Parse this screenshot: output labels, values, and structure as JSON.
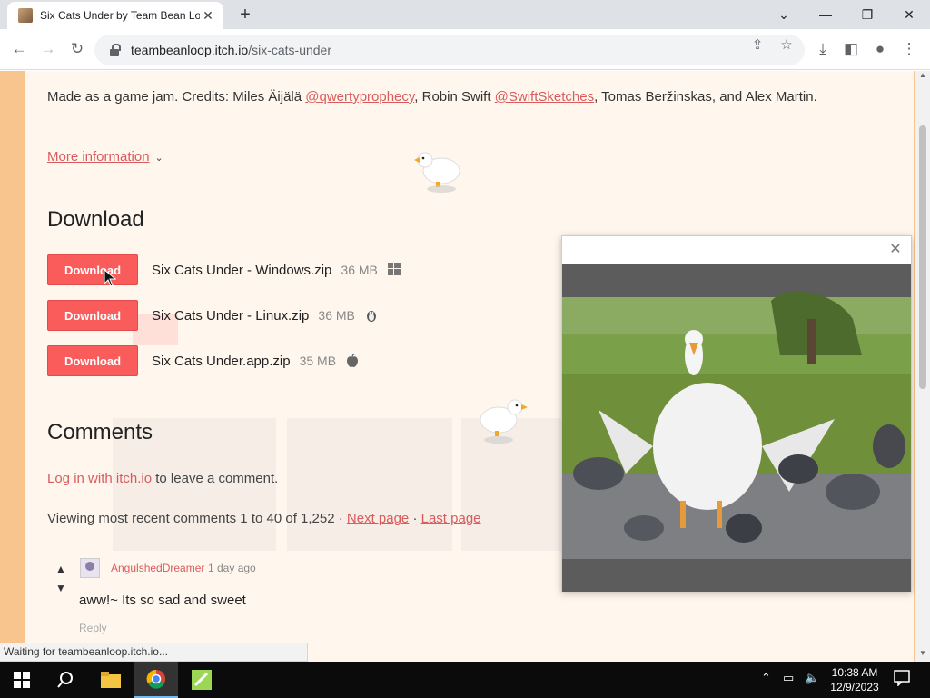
{
  "browser": {
    "tab_title": "Six Cats Under by Team Bean Lo",
    "url_host": "teambeanloop.itch.io",
    "url_path": "/six-cats-under",
    "status_text": "Waiting for teambeanloop.itch.io..."
  },
  "page": {
    "credits_prefix": "Made as a game jam. Credits: Miles Äijälä ",
    "credit_link_1": "@qwertyprophecy",
    "credits_mid": ", Robin Swift ",
    "credit_link_2": "@SwiftSketches",
    "credits_suffix": ", Tomas Beržinskas, and Alex Martin.",
    "more_info": "More information",
    "download_heading": "Download",
    "downloads": [
      {
        "button": "Download",
        "name": "Six Cats Under - Windows.zip",
        "size": "36 MB",
        "os_icon": "windows-icon"
      },
      {
        "button": "Download",
        "name": "Six Cats Under - Linux.zip",
        "size": "36 MB",
        "os_icon": "linux-icon"
      },
      {
        "button": "Download",
        "name": "Six Cats Under.app.zip",
        "size": "35 MB",
        "os_icon": "apple-icon"
      }
    ],
    "comments_heading": "Comments",
    "login_link": "Log in with itch.io",
    "login_suffix": " to leave a comment.",
    "viewing_prefix": "Viewing most recent comments 1 to 40 of 1,252 · ",
    "next_page": "Next page",
    "separator": " · ",
    "last_page": "Last page",
    "comment": {
      "user": "AngulshedDreamer",
      "date": "1 day ago",
      "body": "aww!~ Its so sad and sweet",
      "reply": "Reply"
    }
  },
  "taskbar": {
    "time": "10:38 AM",
    "date": "12/9/2023"
  },
  "colors": {
    "accent": "#fa5c5c",
    "link": "#da5b5b",
    "page_bg": "#fff7ee",
    "side_bg": "#f9c58f"
  }
}
